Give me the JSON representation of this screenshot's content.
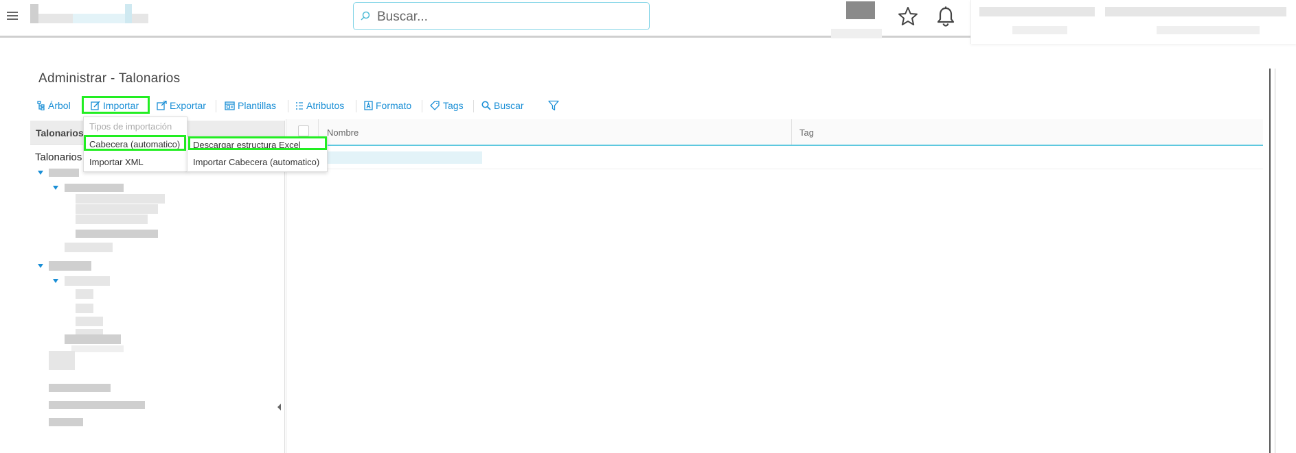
{
  "header": {
    "search_placeholder": "Buscar..."
  },
  "page": {
    "title": "Administrar - Talonarios"
  },
  "toolbar": {
    "arbol": "Árbol",
    "importar": "Importar",
    "exportar": "Exportar",
    "plantillas": "Plantillas",
    "atributos": "Atributos",
    "formato": "Formato",
    "tags": "Tags",
    "buscar": "Buscar"
  },
  "import_menu": {
    "header": "Tipos de importación",
    "items": [
      "Cabecera (automatico)",
      "Importar XML"
    ]
  },
  "submenu": {
    "items": [
      "Descargar estructura Excel",
      "Importar Cabecera (automatico)"
    ]
  },
  "left_panel": {
    "header": "Talonarios",
    "root": "Talonarios"
  },
  "grid": {
    "columns": [
      "Nombre",
      "Tag"
    ]
  },
  "colors": {
    "accent": "#1a8fd6",
    "highlight": "#22ee22"
  }
}
